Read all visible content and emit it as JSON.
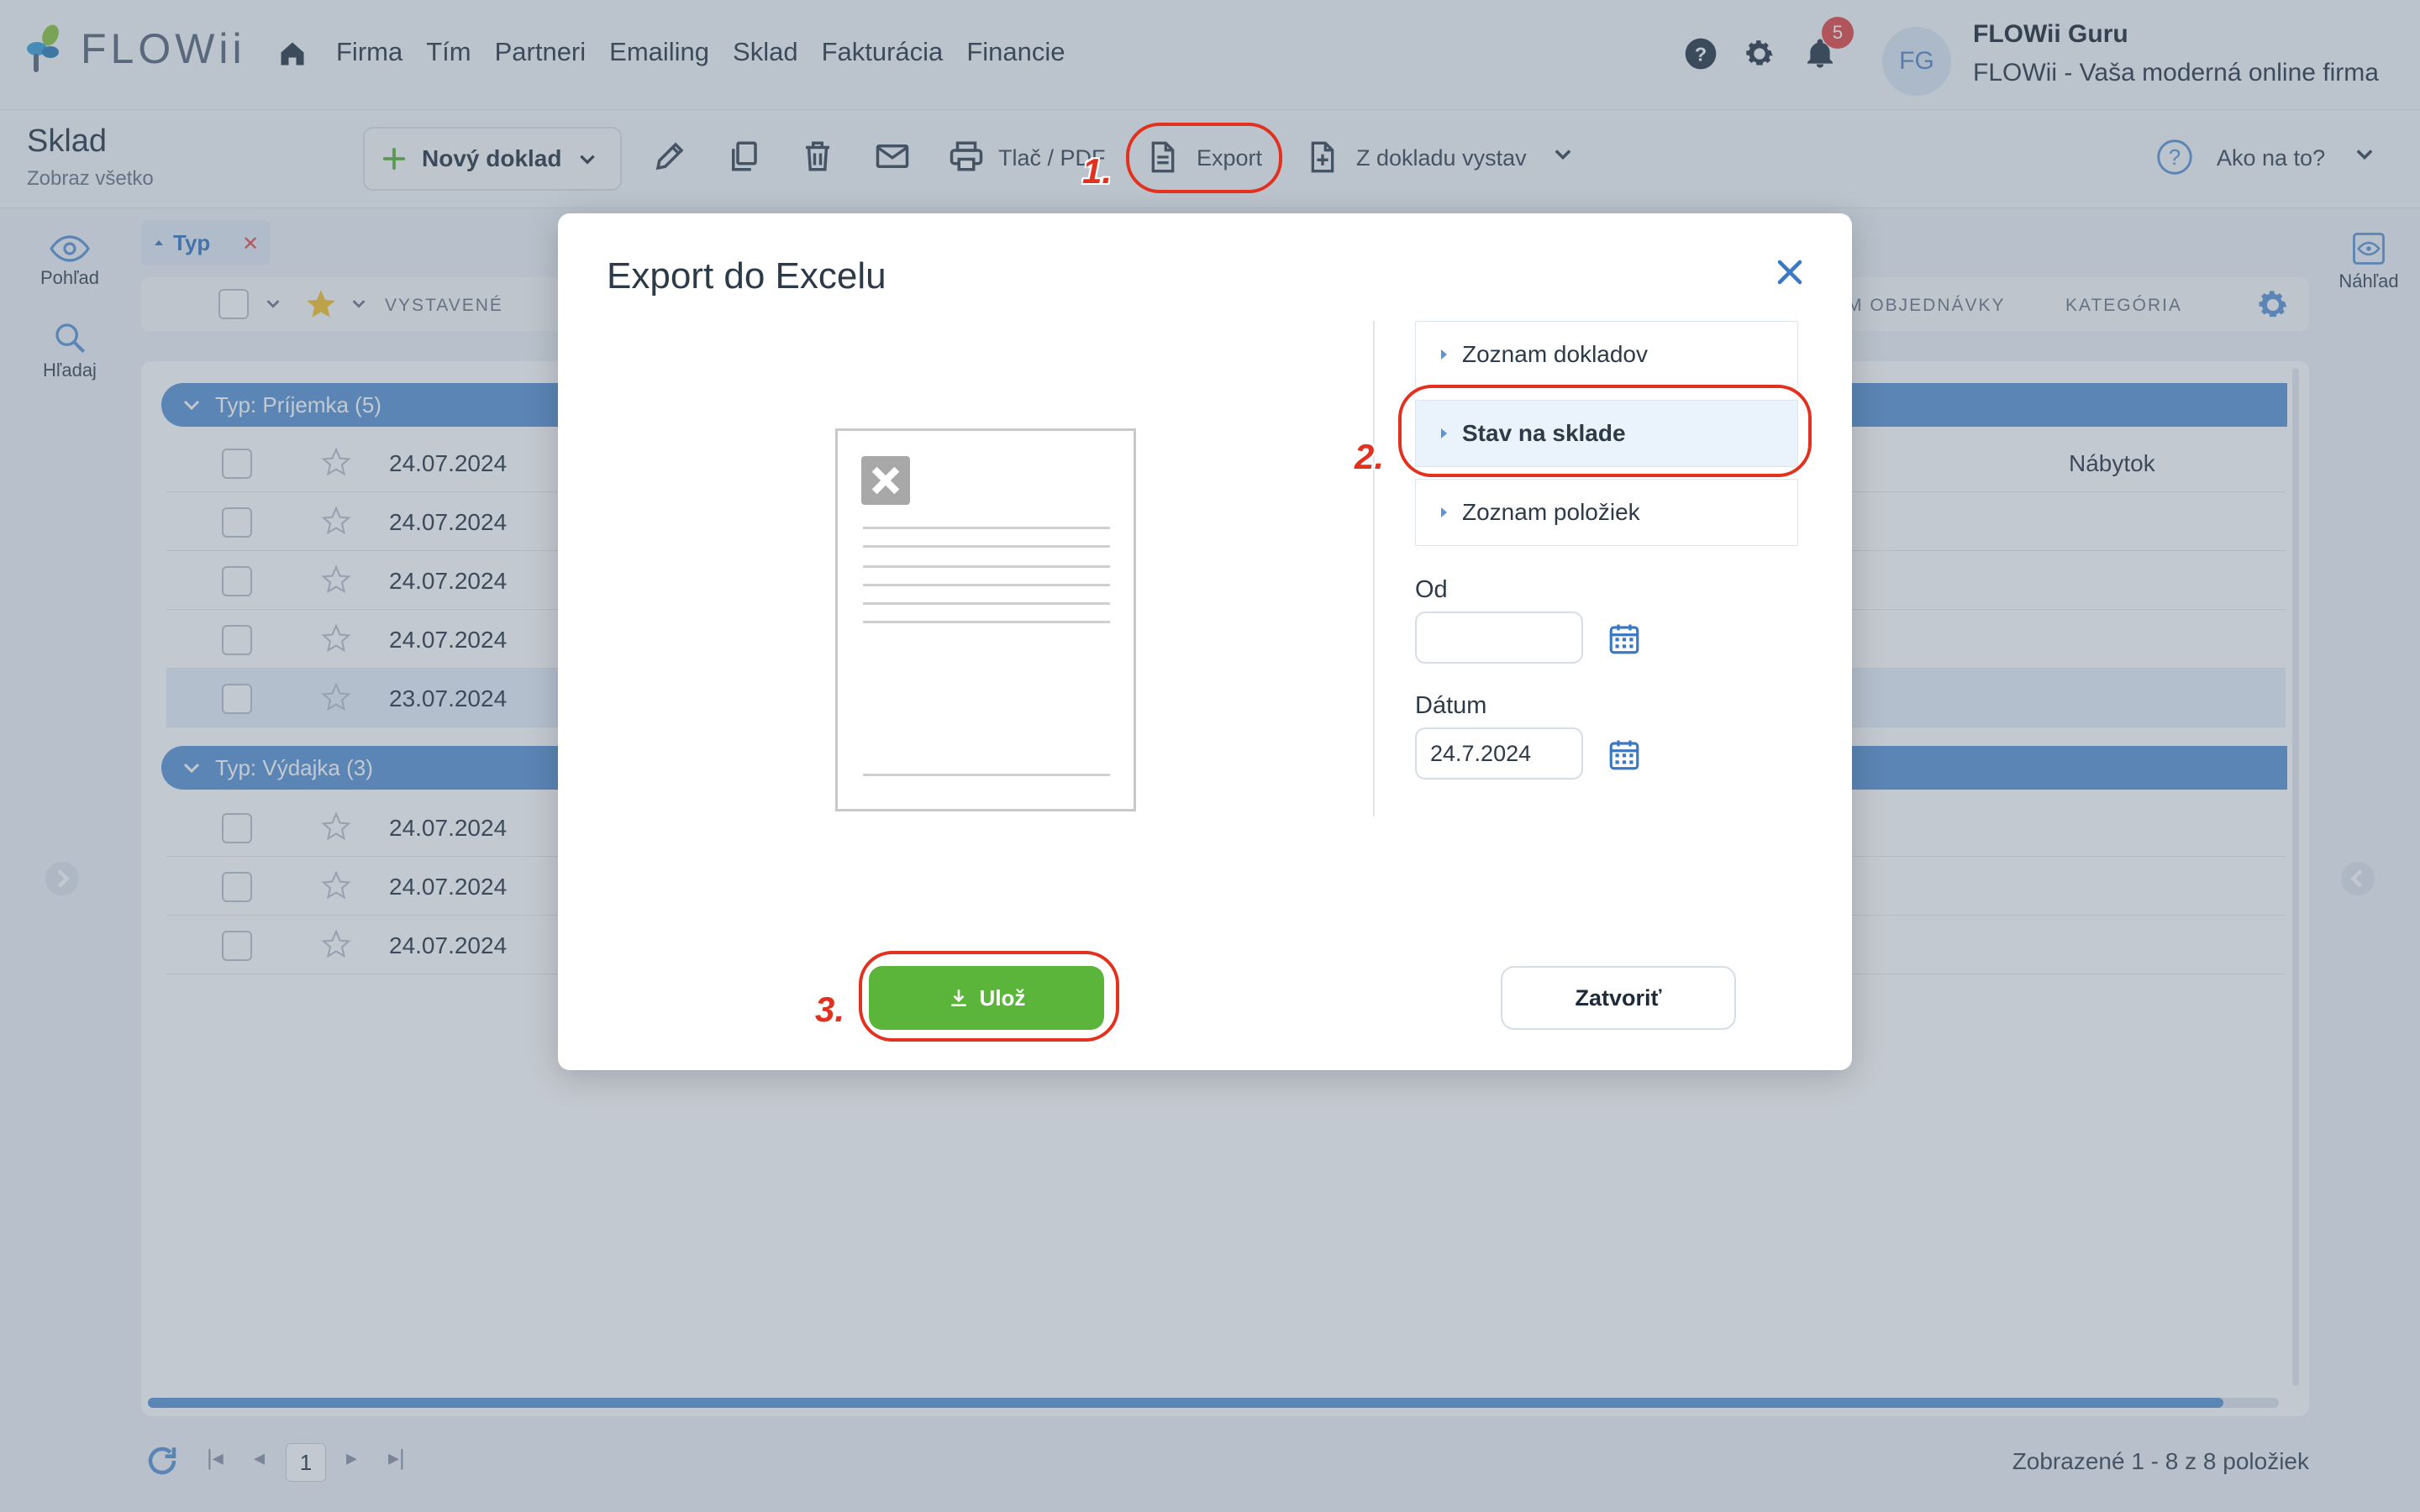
{
  "app": {
    "name": "FLOWii"
  },
  "nav": {
    "items": [
      "Firma",
      "Tím",
      "Partneri",
      "Emailing",
      "Sklad",
      "Fakturácia",
      "Financie"
    ]
  },
  "header": {
    "notification_count": "5",
    "avatar_initials": "FG",
    "user_name": "FLOWii Guru",
    "company": "FLOWii - Vaša moderná online firma"
  },
  "toolbar": {
    "title": "Sklad",
    "subtitle": "Zobraz všetko",
    "new_doc": "Nový doklad",
    "print_pdf": "Tlač / PDF",
    "export": "Export",
    "from_doc": "Z dokladu vystav",
    "help": "Ako na to?"
  },
  "left_rail": {
    "view": "Pohľad",
    "search": "Hľadaj"
  },
  "right_rail": {
    "preview": "Náhľad"
  },
  "filter": {
    "chip": "Typ"
  },
  "grid_header": {
    "issued": "VYSTAVENÉ",
    "order_num": "M OBJEDNÁVKY",
    "category": "KATEGÓRIA"
  },
  "groups": [
    {
      "label": "Typ: Príjemka (5)",
      "rows": [
        {
          "date": "24.07.2024",
          "category": "Nábytok"
        },
        {
          "date": "24.07.2024",
          "category": ""
        },
        {
          "date": "24.07.2024",
          "category": ""
        },
        {
          "date": "24.07.2024",
          "category": ""
        },
        {
          "date": "23.07.2024",
          "category": ""
        }
      ]
    },
    {
      "label": "Typ: Výdajka (3)",
      "rows": [
        {
          "date": "24.07.2024",
          "category": ""
        },
        {
          "date": "24.07.2024",
          "category": ""
        },
        {
          "date": "24.07.2024",
          "category": ""
        }
      ]
    }
  ],
  "pager": {
    "page": "1",
    "info": "Zobrazené 1 - 8 z 8 položiek"
  },
  "modal": {
    "title": "Export do Excelu",
    "options": [
      "Zoznam dokladov",
      "Stav na sklade",
      "Zoznam položiek"
    ],
    "selected_option": "Stav na sklade",
    "from_label": "Od",
    "from_value": "",
    "date_label": "Dátum",
    "date_value": "24.7.2024",
    "save": "Ulož",
    "close": "Zatvoriť"
  },
  "annotations": {
    "step1": "1.",
    "step2": "2.",
    "step3": "3.",
    "color": "#e2321f"
  }
}
